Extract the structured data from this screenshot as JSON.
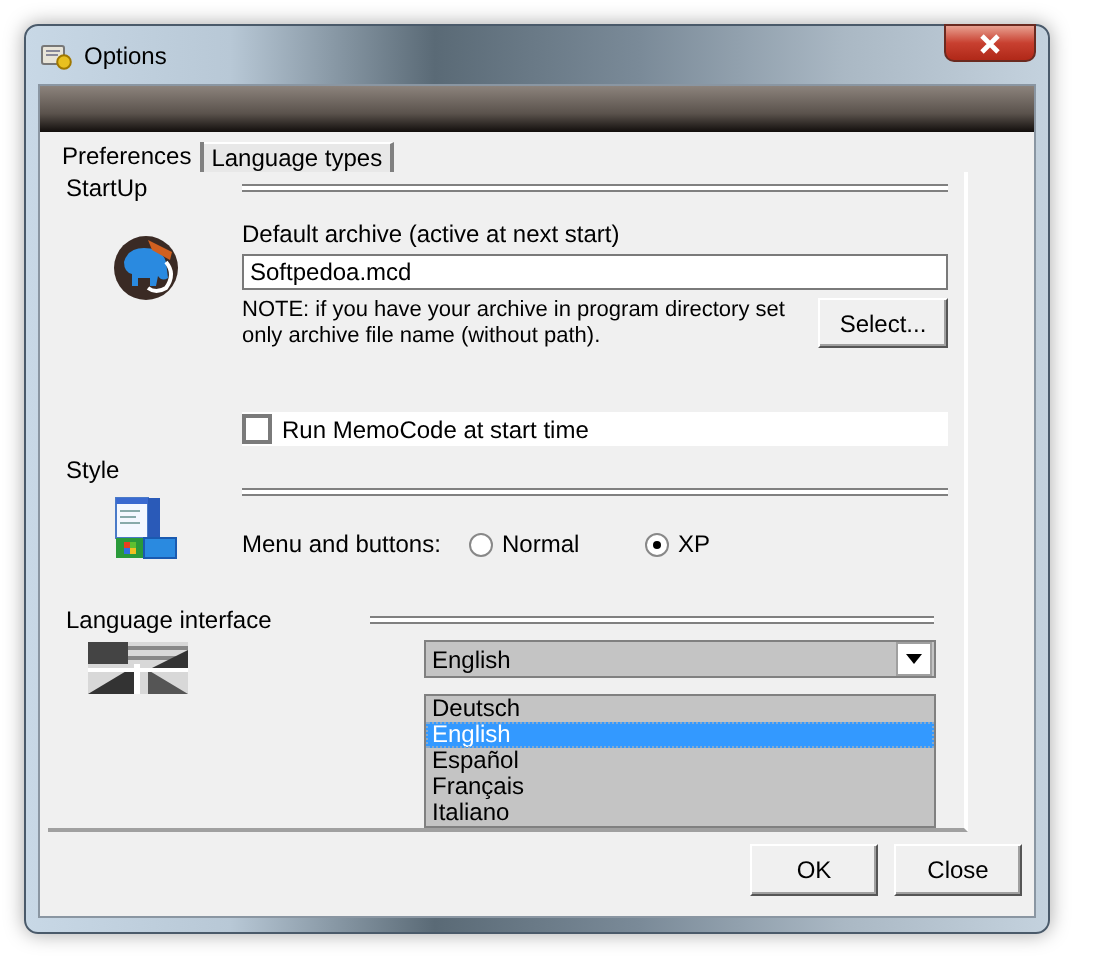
{
  "window": {
    "title": "Options"
  },
  "tabs": [
    {
      "label": "Preferences",
      "selected": true
    },
    {
      "label": "Language types",
      "selected": false
    }
  ],
  "startup": {
    "heading": "StartUp",
    "archive_label": "Default archive (active at next start)",
    "archive_value": "Softpedoa.mcd",
    "note": "NOTE: if you have your archive in program directory set only archive file name (without path).",
    "select_button": "Select...",
    "run_at_start": {
      "label": "Run MemoCode at start time",
      "checked": false
    }
  },
  "style": {
    "heading": "Style",
    "label": "Menu and  buttons:",
    "options": [
      {
        "label": "Normal",
        "selected": false
      },
      {
        "label": "XP",
        "selected": true
      }
    ]
  },
  "language": {
    "heading": "Language interface",
    "value": "English",
    "expanded": true,
    "options": [
      {
        "label": "Deutsch",
        "selected": false
      },
      {
        "label": "English",
        "selected": true
      },
      {
        "label": "Español",
        "selected": false
      },
      {
        "label": "Français",
        "selected": false
      },
      {
        "label": "Italiano",
        "selected": false
      }
    ]
  },
  "buttons": [
    "OK",
    "Close"
  ]
}
